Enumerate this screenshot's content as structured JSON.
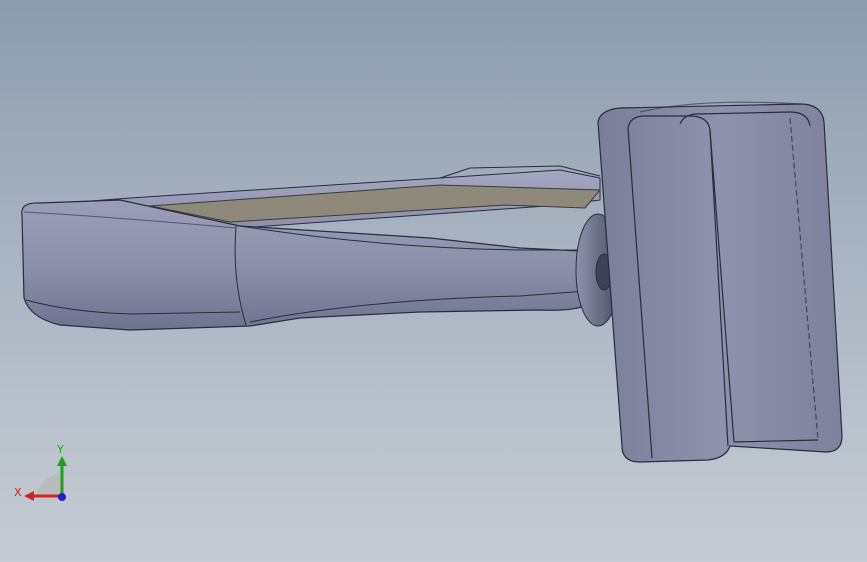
{
  "viewport": {
    "background_top": "#8c9cae",
    "background_bottom": "#c6ccd4"
  },
  "model": {
    "body_color": "#8a8ea8",
    "edge_color": "#2a2c3a",
    "screen_color": "#8e897a"
  },
  "triad": {
    "x_label": "X",
    "y_label": "Y",
    "x_color": "#d42020",
    "y_color": "#20a020",
    "z_color": "#2020d0"
  }
}
